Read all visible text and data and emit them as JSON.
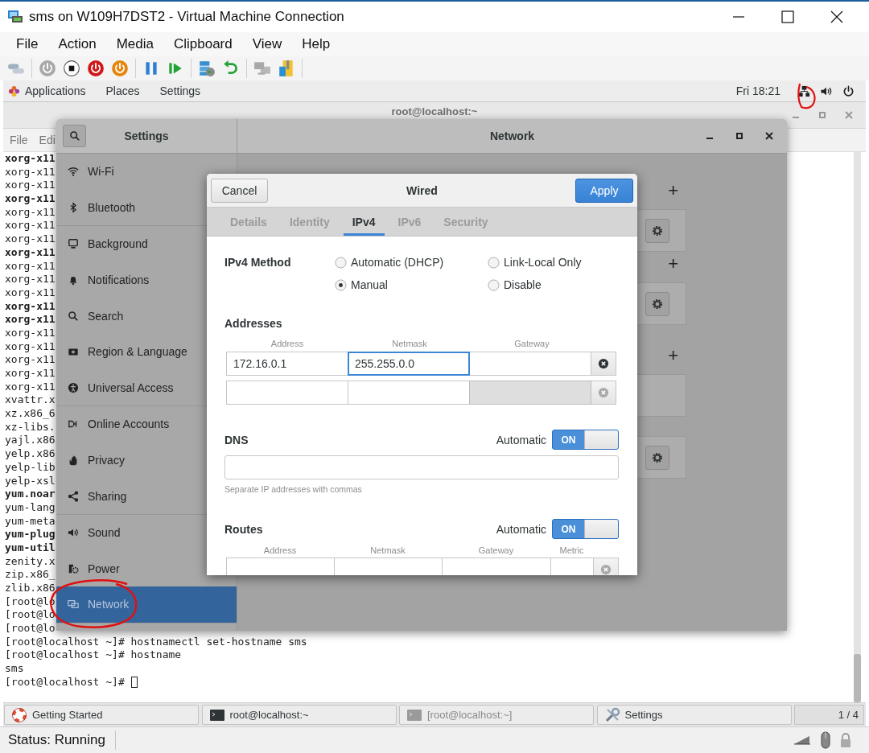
{
  "window": {
    "title": "sms on W109H7DST2 - Virtual Machine Connection"
  },
  "menu": [
    "File",
    "Action",
    "Media",
    "Clipboard",
    "View",
    "Help"
  ],
  "toolbar": [
    {
      "kind": "keys",
      "disabled": false
    },
    {
      "kind": "start",
      "disabled": true
    },
    {
      "kind": "turn_off",
      "disabled": false
    },
    {
      "kind": "shutdown",
      "disabled": false
    },
    {
      "kind": "save",
      "disabled": false
    },
    {
      "kind": "pause",
      "disabled": false
    },
    {
      "kind": "reset",
      "disabled": false
    },
    {
      "kind": "checkpoint",
      "disabled": false
    },
    {
      "kind": "revert",
      "disabled": false
    },
    {
      "kind": "enhanced",
      "disabled": true
    },
    {
      "kind": "share",
      "disabled": false
    }
  ],
  "top_bar": {
    "menus": [
      "Applications",
      "Places",
      "Settings"
    ],
    "clock": "Fri 18:21"
  },
  "terminal": {
    "title": "root@localhost:~",
    "menu": [
      "File",
      "Edi"
    ],
    "lines": [
      {
        "text": "xorg-x11",
        "bold": true,
        "cursor": false
      },
      {
        "text": "xorg-x11",
        "bold": false,
        "cursor": false
      },
      {
        "text": "xorg-x11",
        "bold": false,
        "cursor": false
      },
      {
        "text": "xorg-x11",
        "bold": true,
        "cursor": false
      },
      {
        "text": "xorg-x11",
        "bold": false,
        "cursor": false
      },
      {
        "text": "xorg-x11",
        "bold": false,
        "cursor": false
      },
      {
        "text": "xorg-x11",
        "bold": false,
        "cursor": false
      },
      {
        "text": "xorg-x11",
        "bold": true,
        "cursor": false
      },
      {
        "text": "xorg-x11",
        "bold": false,
        "cursor": false
      },
      {
        "text": "xorg-x11",
        "bold": false,
        "cursor": false
      },
      {
        "text": "xorg-x11",
        "bold": false,
        "cursor": false
      },
      {
        "text": "xorg-x11",
        "bold": true,
        "cursor": false
      },
      {
        "text": "xorg-x11",
        "bold": true,
        "cursor": false
      },
      {
        "text": "xorg-x11",
        "bold": false,
        "cursor": false
      },
      {
        "text": "xorg-x11",
        "bold": false,
        "cursor": false
      },
      {
        "text": "xorg-x11",
        "bold": false,
        "cursor": false
      },
      {
        "text": "xorg-x11",
        "bold": false,
        "cursor": false
      },
      {
        "text": "xorg-x11",
        "bold": false,
        "cursor": false
      },
      {
        "text": "xvattr.x",
        "bold": false,
        "cursor": false
      },
      {
        "text": "xz.x86_6",
        "bold": false,
        "cursor": false
      },
      {
        "text": "xz-libs.",
        "bold": false,
        "cursor": false
      },
      {
        "text": "yajl.x86",
        "bold": false,
        "cursor": false
      },
      {
        "text": "yelp.x86",
        "bold": false,
        "cursor": false
      },
      {
        "text": "yelp-lib",
        "bold": false,
        "cursor": false
      },
      {
        "text": "yelp-xsl",
        "bold": false,
        "cursor": false
      },
      {
        "text": "yum.noar",
        "bold": true,
        "cursor": false
      },
      {
        "text": "yum-lang",
        "bold": false,
        "cursor": false
      },
      {
        "text": "yum-meta",
        "bold": false,
        "cursor": false
      },
      {
        "text": "yum-plug",
        "bold": true,
        "cursor": false
      },
      {
        "text": "yum-util",
        "bold": true,
        "cursor": false
      },
      {
        "text": "zenity.x",
        "bold": false,
        "cursor": false
      },
      {
        "text": "zip.x86_",
        "bold": false,
        "cursor": false
      },
      {
        "text": "zlib.x86",
        "bold": false,
        "cursor": false
      },
      {
        "text": "[root@lo",
        "bold": false,
        "cursor": false
      },
      {
        "text": "[root@lo",
        "bold": false,
        "cursor": false
      },
      {
        "text": "[root@lo",
        "bold": false,
        "cursor": false
      },
      {
        "text": "[root@localhost ~]# hostnamectl set-hostname sms",
        "bold": false,
        "cursor": false
      },
      {
        "text": "[root@localhost ~]# hostname",
        "bold": false,
        "cursor": false
      },
      {
        "text": "sms",
        "bold": false,
        "cursor": false
      },
      {
        "text": "[root@localhost ~]#",
        "bold": false,
        "cursor": true
      }
    ]
  },
  "settings": {
    "title": "Settings",
    "panel_title": "Network",
    "sidebar": {
      "groups": [
        [
          {
            "label": "Wi-Fi",
            "selected": false
          },
          {
            "label": "Bluetooth",
            "selected": false
          }
        ],
        [
          {
            "label": "Background",
            "selected": false
          },
          {
            "label": "Notifications",
            "selected": false
          },
          {
            "label": "Search",
            "selected": false
          },
          {
            "label": "Region & Language",
            "selected": false
          },
          {
            "label": "Universal Access",
            "selected": false
          }
        ],
        [
          {
            "label": "Online Accounts",
            "selected": false
          },
          {
            "label": "Privacy",
            "selected": false
          },
          {
            "label": "Sharing",
            "selected": false
          }
        ],
        [
          {
            "label": "Sound",
            "selected": false
          },
          {
            "label": "Power",
            "selected": false
          },
          {
            "label": "Network",
            "selected": true
          }
        ]
      ]
    },
    "network_panel": {
      "sections": [
        {
          "add": "+",
          "settings_button": true
        },
        {
          "add": "+",
          "settings_button": true
        },
        {
          "add": "+",
          "settings_button": false
        },
        {
          "settings_button": true
        }
      ]
    }
  },
  "dialog": {
    "title": "Wired",
    "cancel": "Cancel",
    "apply": "Apply",
    "tabs": [
      {
        "label": "Details",
        "selected": false
      },
      {
        "label": "Identity",
        "selected": false
      },
      {
        "label": "IPv4",
        "selected": true
      },
      {
        "label": "IPv6",
        "selected": false
      },
      {
        "label": "Security",
        "selected": false
      }
    ],
    "ipv4_method": {
      "label": "IPv4 Method",
      "options": [
        {
          "label": "Automatic (DHCP)",
          "selected": false
        },
        {
          "label": "Link-Local Only",
          "selected": false
        },
        {
          "label": "Manual",
          "selected": true
        },
        {
          "label": "Disable",
          "selected": false
        }
      ]
    },
    "addresses": {
      "title": "Addresses",
      "columns": [
        "Address",
        "Netmask",
        "Gateway"
      ],
      "rows": [
        {
          "cells": [
            {
              "value": "172.16.0.1",
              "focused": false,
              "disabled": false
            },
            {
              "value": "255.255.0.0",
              "focused": true,
              "disabled": false
            },
            {
              "focused": false,
              "disabled": false
            }
          ],
          "delete_disabled": false
        },
        {
          "cells": [
            {
              "focused": false,
              "disabled": false
            },
            {
              "focused": false,
              "disabled": false
            },
            {
              "focused": false,
              "disabled": true
            }
          ],
          "delete_disabled": true
        }
      ]
    },
    "dns": {
      "title": "DNS",
      "automatic_label": "Automatic",
      "on": true,
      "switch_text": "ON",
      "hint": "Separate IP addresses with commas"
    },
    "routes": {
      "title": "Routes",
      "automatic_label": "Automatic",
      "on": true,
      "switch_text": "ON",
      "columns": [
        "Address",
        "Netmask",
        "Gateway",
        "Metric"
      ]
    }
  },
  "taskbar": {
    "items": [
      {
        "label": "Getting Started",
        "minimized": false
      },
      {
        "label": "root@localhost:~",
        "minimized": false
      },
      {
        "label": "[root@localhost:~]",
        "minimized": true
      },
      {
        "label": "Settings",
        "minimized": false
      }
    ],
    "pager": "1 / 4"
  },
  "status_bar": {
    "status": "Status: Running"
  }
}
